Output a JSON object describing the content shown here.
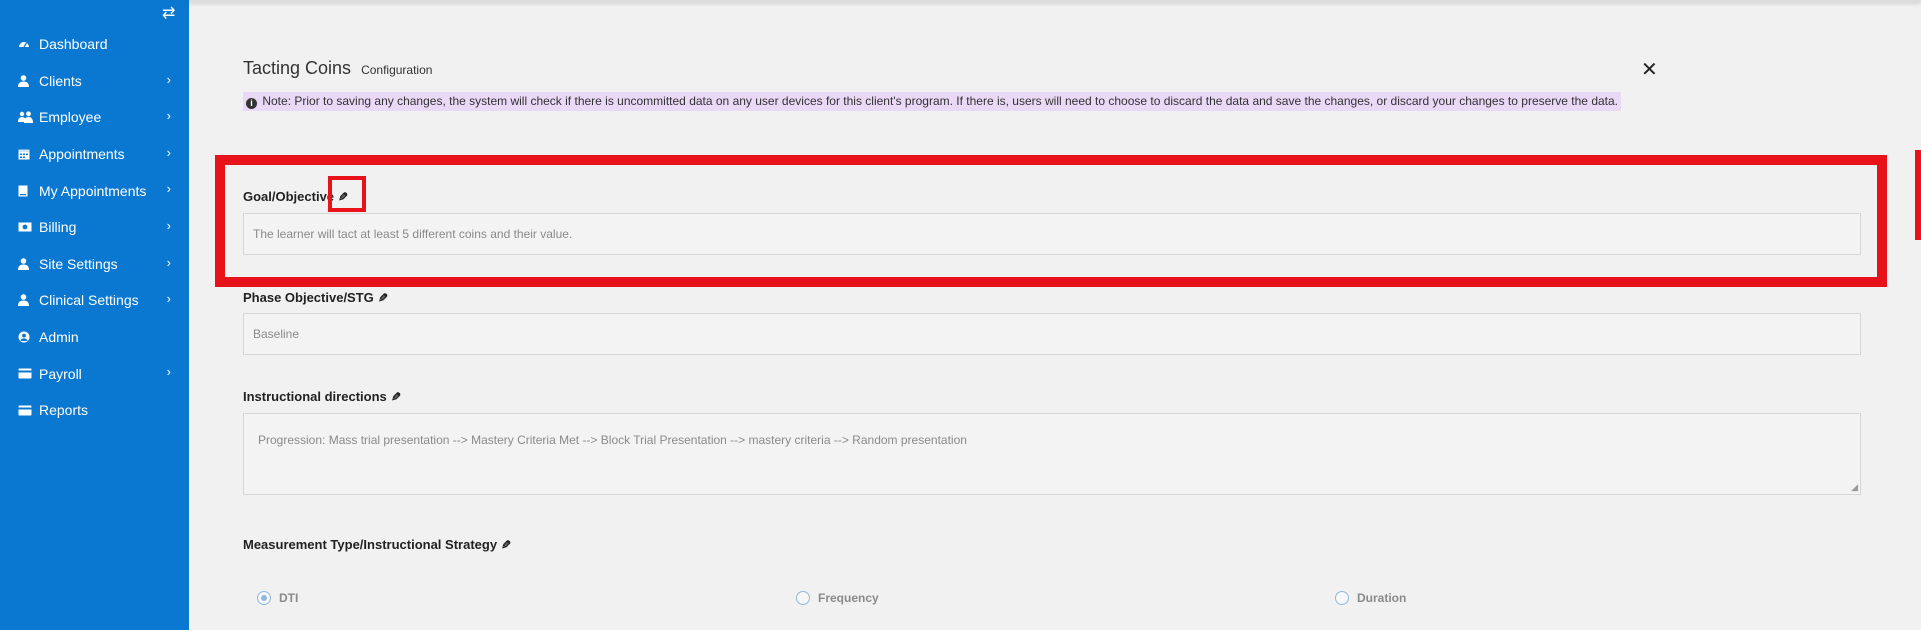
{
  "sidebar": {
    "toggle_icon": "swap-arrows-icon",
    "items": [
      {
        "label": "Dashboard",
        "icon": "dashboard-icon",
        "has_children": false
      },
      {
        "label": "Clients",
        "icon": "user-icon",
        "has_children": true
      },
      {
        "label": "Employee",
        "icon": "users-icon",
        "has_children": true
      },
      {
        "label": "Appointments",
        "icon": "calendar-icon",
        "has_children": true
      },
      {
        "label": "My Appointments",
        "icon": "book-icon",
        "has_children": true
      },
      {
        "label": "Billing",
        "icon": "money-icon",
        "has_children": true
      },
      {
        "label": "Site Settings",
        "icon": "user-icon",
        "has_children": true
      },
      {
        "label": "Clinical Settings",
        "icon": "user-icon",
        "has_children": true
      },
      {
        "label": "Admin",
        "icon": "user-circle-icon",
        "has_children": false
      },
      {
        "label": "Payroll",
        "icon": "credit-card-icon",
        "has_children": true
      },
      {
        "label": "Reports",
        "icon": "credit-card-icon",
        "has_children": false
      }
    ],
    "chevron": "›"
  },
  "header": {
    "title": "Tacting Coins",
    "subtitle": "Configuration",
    "close_symbol": "✕"
  },
  "note": {
    "text": "Note: Prior to saving any changes, the system will check if there is uncommitted data on any user devices for this client's program. If there is, users will need to choose to discard the data and save the changes, or discard your changes to preserve the data."
  },
  "fields": {
    "goal": {
      "label": "Goal/Objective",
      "value": "The learner will tact at least 5 different coins and their value."
    },
    "phase": {
      "label": "Phase Objective/STG",
      "value": "Baseline"
    },
    "directions": {
      "label": "Instructional directions",
      "value": "Progression: Mass trial presentation --> Mastery Criteria Met --> Block Trial Presentation --> mastery criteria --> Random presentation"
    },
    "measurement": {
      "label": "Measurement Type/Instructional Strategy"
    }
  },
  "measurement_options": [
    {
      "label": "DTI",
      "checked": true
    },
    {
      "label": "Frequency",
      "checked": false
    },
    {
      "label": "Duration",
      "checked": false
    }
  ],
  "colors": {
    "sidebar_bg": "#0a78d1",
    "highlight": "#e8121b",
    "note_bg": "#e9d8f6"
  }
}
